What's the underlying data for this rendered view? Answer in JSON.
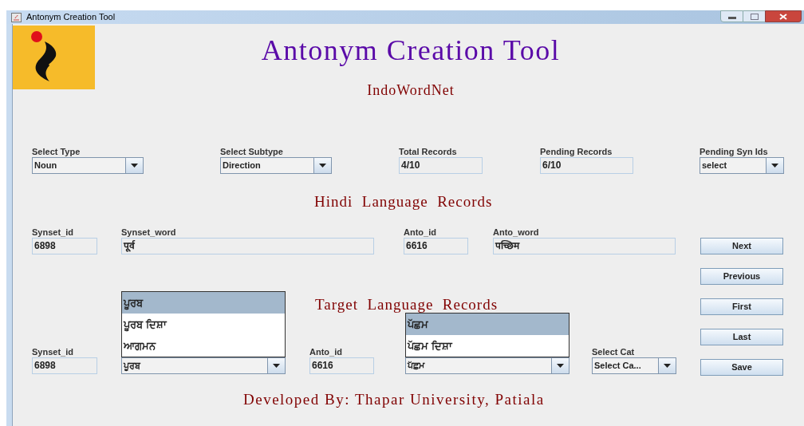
{
  "window": {
    "title": "Antonym Creation Tool"
  },
  "header": {
    "title": "Antonym Creation Tool",
    "subtitle": "IndoWordNet"
  },
  "filters": [
    {
      "kind": "combo",
      "label": "Select Type",
      "value": "Noun"
    },
    {
      "kind": "combo",
      "label": "Select Subtype",
      "value": "Direction"
    },
    {
      "kind": "text",
      "label": "Total Records",
      "value": "4/10"
    },
    {
      "kind": "text",
      "label": "Pending Records",
      "value": "6/10"
    },
    {
      "kind": "combo",
      "label": "Pending Syn Ids",
      "value": "select"
    }
  ],
  "hindi_records": {
    "heading": "Hindi  Language  Records",
    "fields": [
      {
        "kind": "text",
        "label": "Synset_id",
        "value": "6898"
      },
      {
        "kind": "text",
        "label": "Synset_word",
        "value": "पूर्व"
      },
      {
        "kind": "text",
        "label": "Anto_id",
        "value": "6616"
      },
      {
        "kind": "text",
        "label": "Anto_word",
        "value": "पच्छिम"
      }
    ]
  },
  "target_records": {
    "heading": "Target  Language  Records",
    "fields": [
      {
        "kind": "text",
        "label": "Synset_id",
        "value": "6898"
      },
      {
        "kind": "combo",
        "value": "ਪੂਰਬ",
        "expanded": true,
        "options": [
          {
            "label": "ਪੂਰਬ",
            "selected": true
          },
          {
            "label": "ਪੂਰਬ ਦਿਸ਼ਾ",
            "selected": false
          },
          {
            "label": "ਆਗਮਨ",
            "selected": false
          }
        ]
      },
      {
        "kind": "text",
        "label": "Anto_id",
        "value": "6616"
      },
      {
        "kind": "combo",
        "value": "ਪੱਛਮ",
        "expanded": true,
        "options": [
          {
            "label": "ਪੱਛਮ",
            "selected": true
          },
          {
            "label": "ਪੱਛਮ ਦਿਸ਼ਾ",
            "selected": false
          }
        ]
      },
      {
        "kind": "combo",
        "label": "Select Cat",
        "value": "Select Ca..."
      }
    ]
  },
  "buttons": [
    "Next",
    "Previous",
    "First",
    "Last",
    "Save"
  ],
  "footer": "Developed By: Thapar University, Patiala"
}
